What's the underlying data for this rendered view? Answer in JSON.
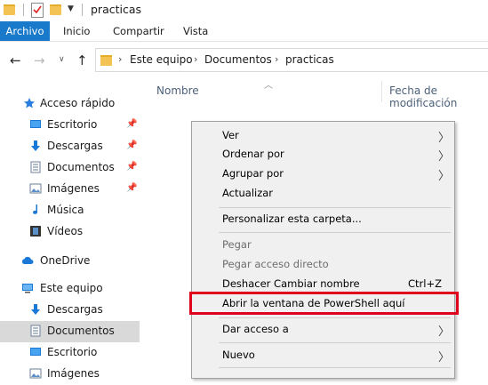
{
  "window": {
    "title": "practicas"
  },
  "ribbon": {
    "tabs": [
      "Archivo",
      "Inicio",
      "Compartir",
      "Vista"
    ]
  },
  "address": {
    "crumbs": [
      "Este equipo",
      "Documentos",
      "practicas"
    ]
  },
  "columns": {
    "name": "Nombre",
    "date": "Fecha de modificación"
  },
  "sidebar": {
    "quick_access": "Acceso rápido",
    "quick_items": [
      "Escritorio",
      "Descargas",
      "Documentos",
      "Imágenes",
      "Música",
      "Vídeos"
    ],
    "onedrive": "OneDrive",
    "this_pc": "Este equipo",
    "pc_items": [
      "Descargas",
      "Documentos",
      "Escritorio",
      "Imágenes"
    ],
    "selected": "Documentos"
  },
  "context_menu": {
    "items": [
      {
        "label": "Ver"
      },
      {
        "label": "Ordenar por"
      },
      {
        "label": "Agrupar por"
      },
      {
        "label": "Actualizar"
      },
      {
        "label": "Personalizar esta carpeta..."
      },
      {
        "label": "Pegar"
      },
      {
        "label": "Pegar acceso directo"
      },
      {
        "label": "Deshacer Cambiar nombre",
        "shortcut": "Ctrl+Z"
      },
      {
        "label": "Abrir la ventana de PowerShell aquí"
      },
      {
        "label": "Dar acceso a"
      },
      {
        "label": "Nuevo"
      }
    ]
  },
  "colors": {
    "accent": "#1979ca",
    "highlight_box": "#e0001e",
    "folder": "#f3c453"
  }
}
